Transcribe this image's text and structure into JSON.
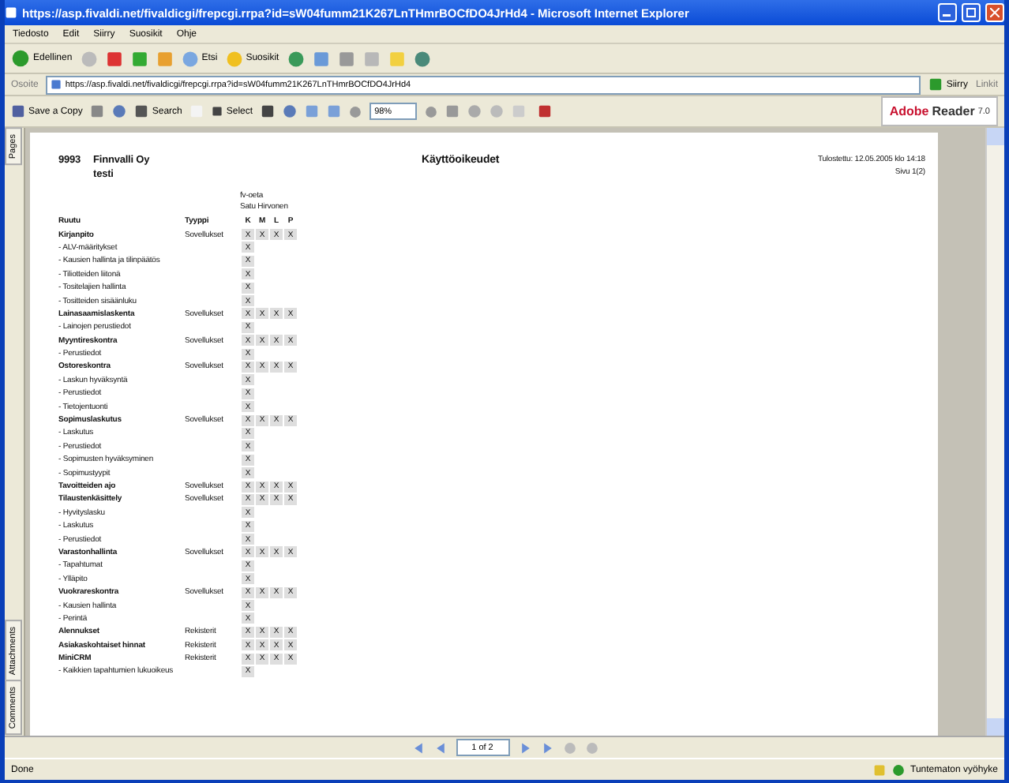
{
  "window": {
    "title": "https://asp.fivaldi.net/fivaldicgi/frepcgi.rrpa?id=sW04fumm21K267LnTHmrBOCfDO4JrHd4 - Microsoft Internet Explorer"
  },
  "menu": [
    "Tiedosto",
    "Edit",
    "Siirry",
    "Suosikit",
    "Ohje"
  ],
  "ie_toolbar": {
    "back_label": "Edellinen",
    "search_label": "Etsi",
    "favorites_label": "Suosikit"
  },
  "address_bar": {
    "label": "Osoite",
    "url": "https://asp.fivaldi.net/fivaldicgi/frepcgi.rrpa?id=sW04fumm21K267LnTHmrBOCfDO4JrHd4",
    "go_label": "Siirry",
    "links_label": "Linkit"
  },
  "reader_toolbar": {
    "save_label": "Save a Copy",
    "search_label": "Search",
    "select_label": "Select",
    "zoom": "98%",
    "brand": "Adobe",
    "brand_product": "Reader",
    "brand_version": "7.0"
  },
  "side_tabs": [
    {
      "label": "Pages"
    },
    {
      "label": "Attachments"
    },
    {
      "label": "Comments"
    }
  ],
  "document": {
    "company_code": "9993",
    "company": "Finnvalli Oy",
    "company_line2": "testi",
    "title": "Käyttöoikeudet",
    "printed": "Tulostettu: 12.05.2005 klo 14:18",
    "page": "Sivu 1(2)",
    "group": "fv-oeta",
    "user": "Satu Hirvonen",
    "columns": [
      "Ruutu",
      "Tyyppi"
    ],
    "perm_columns": [
      "K",
      "M",
      "L",
      "P"
    ],
    "rows": [
      {
        "kind": "group",
        "name": "Kirjanpito",
        "type": "Sovellukset",
        "perms": [
          "X",
          "X",
          "X",
          "X"
        ]
      },
      {
        "kind": "sub",
        "name": "- ALV-määritykset",
        "perms": [
          "X"
        ]
      },
      {
        "kind": "sub",
        "name": "- Kausien hallinta ja tilinpäätös",
        "perms": [
          "X"
        ]
      },
      {
        "kind": "sub",
        "name": "- Tiliotteiden liitonä",
        "perms": [
          "X"
        ]
      },
      {
        "kind": "sub",
        "name": "- Tositelajien hallinta",
        "perms": [
          "X"
        ]
      },
      {
        "kind": "sub",
        "name": "- Tositteiden sisäänluku",
        "perms": [
          "X"
        ]
      },
      {
        "kind": "group",
        "name": "Lainasaamislaskenta",
        "type": "Sovellukset",
        "perms": [
          "X",
          "X",
          "X",
          "X"
        ]
      },
      {
        "kind": "sub",
        "name": "- Lainojen perustiedot",
        "perms": [
          "X"
        ]
      },
      {
        "kind": "group",
        "name": "Myyntireskontra",
        "type": "Sovellukset",
        "perms": [
          "X",
          "X",
          "X",
          "X"
        ]
      },
      {
        "kind": "sub",
        "name": "- Perustiedot",
        "perms": [
          "X"
        ]
      },
      {
        "kind": "group",
        "name": "Ostoreskontra",
        "type": "Sovellukset",
        "perms": [
          "X",
          "X",
          "X",
          "X"
        ]
      },
      {
        "kind": "sub",
        "name": "- Laskun hyväksyntä",
        "perms": [
          "X"
        ]
      },
      {
        "kind": "sub",
        "name": "- Perustiedot",
        "perms": [
          "X"
        ]
      },
      {
        "kind": "sub",
        "name": "- Tietojentuonti",
        "perms": [
          "X"
        ]
      },
      {
        "kind": "group",
        "name": "Sopimuslaskutus",
        "type": "Sovellukset",
        "perms": [
          "X",
          "X",
          "X",
          "X"
        ]
      },
      {
        "kind": "sub",
        "name": "- Laskutus",
        "perms": [
          "X"
        ]
      },
      {
        "kind": "sub",
        "name": "- Perustiedot",
        "perms": [
          "X"
        ]
      },
      {
        "kind": "sub",
        "name": "- Sopimusten hyväksyminen",
        "perms": [
          "X"
        ]
      },
      {
        "kind": "sub",
        "name": "- Sopimustyypit",
        "perms": [
          "X"
        ]
      },
      {
        "kind": "group",
        "name": "Tavoitteiden ajo",
        "type": "Sovellukset",
        "perms": [
          "X",
          "X",
          "X",
          "X"
        ]
      },
      {
        "kind": "group",
        "name": "Tilaustenkäsittely",
        "type": "Sovellukset",
        "perms": [
          "X",
          "X",
          "X",
          "X"
        ]
      },
      {
        "kind": "sub",
        "name": "- Hyvityslasku",
        "perms": [
          "X"
        ]
      },
      {
        "kind": "sub",
        "name": "- Laskutus",
        "perms": [
          "X"
        ]
      },
      {
        "kind": "sub",
        "name": "- Perustiedot",
        "perms": [
          "X"
        ]
      },
      {
        "kind": "group",
        "name": "Varastonhallinta",
        "type": "Sovellukset",
        "perms": [
          "X",
          "X",
          "X",
          "X"
        ]
      },
      {
        "kind": "sub",
        "name": "- Tapahtumat",
        "perms": [
          "X"
        ]
      },
      {
        "kind": "sub",
        "name": "- Ylläpito",
        "perms": [
          "X"
        ]
      },
      {
        "kind": "group",
        "name": "Vuokrareskontra",
        "type": "Sovellukset",
        "perms": [
          "X",
          "X",
          "X",
          "X"
        ]
      },
      {
        "kind": "sub",
        "name": "- Kausien hallinta",
        "perms": [
          "X"
        ]
      },
      {
        "kind": "sub",
        "name": "- Perintä",
        "perms": [
          "X"
        ]
      },
      {
        "kind": "group",
        "name": "Alennukset",
        "type": "Rekisterit",
        "perms": [
          "X",
          "X",
          "X",
          "X"
        ]
      },
      {
        "kind": "group",
        "name": "Asiakaskohtaiset hinnat",
        "type": "Rekisterit",
        "perms": [
          "X",
          "X",
          "X",
          "X"
        ]
      },
      {
        "kind": "group",
        "name": "MiniCRM",
        "type": "Rekisterit",
        "perms": [
          "X",
          "X",
          "X",
          "X"
        ]
      },
      {
        "kind": "sub",
        "name": "- Kaikkien tapahtumien lukuoikeus",
        "perms": [
          "X"
        ]
      }
    ]
  },
  "page_nav": {
    "page": "1 of 2"
  },
  "status": {
    "text": "Done",
    "zone": "Tuntematon vyöhyke"
  }
}
